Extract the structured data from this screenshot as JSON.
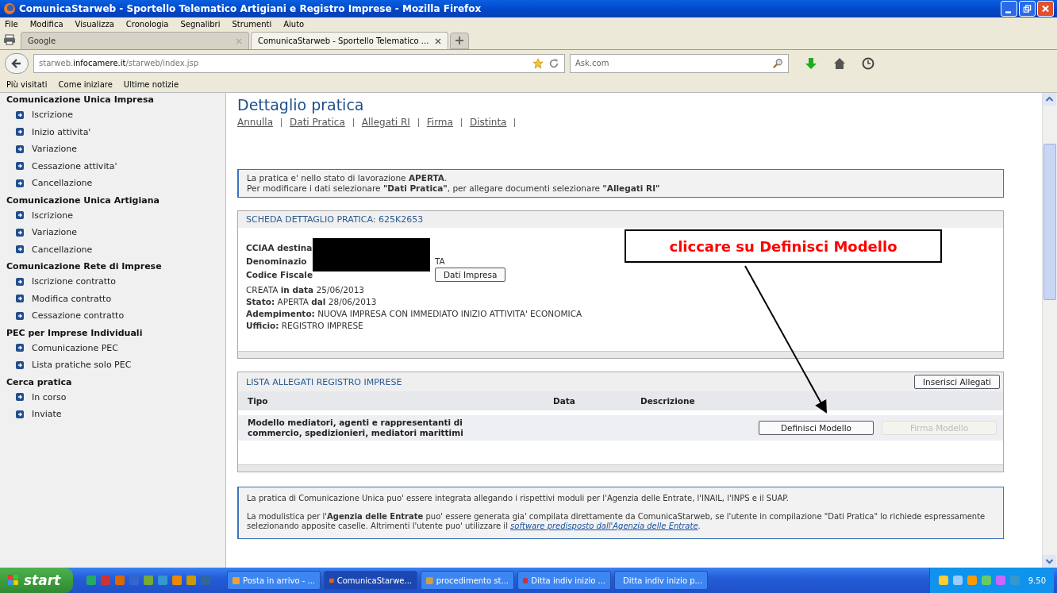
{
  "window": {
    "title": "ComunicaStarweb - Sportello Telematico Artigiani e Registro Imprese - Mozilla Firefox"
  },
  "menu": [
    "File",
    "Modifica",
    "Visualizza",
    "Cronologia",
    "Segnalibri",
    "Strumenti",
    "Aiuto"
  ],
  "tabs": [
    {
      "label": "Google",
      "selected": false
    },
    {
      "label": "ComunicaStarweb - Sportello Telematico ...",
      "selected": true
    }
  ],
  "address": {
    "prefix": "starweb.",
    "domain": "infocamere.it",
    "path": "/starweb/index.jsp"
  },
  "search": {
    "placeholder": "Ask.com"
  },
  "bookmarks": [
    "Più visitati",
    "Come iniziare",
    "Ultime notizie"
  ],
  "sidebar": {
    "sections": [
      {
        "title": "Comunicazione Unica Impresa",
        "items": [
          "Iscrizione",
          "Inizio attivita'",
          "Variazione",
          "Cessazione attivita'",
          "Cancellazione"
        ]
      },
      {
        "title": "Comunicazione Unica Artigiana",
        "items": [
          "Iscrizione",
          "Variazione",
          "Cancellazione"
        ]
      },
      {
        "title": "Comunicazione Rete di Imprese",
        "items": [
          "Iscrizione contratto",
          "Modifica contratto",
          "Cessazione contratto"
        ]
      },
      {
        "title": "PEC per Imprese Individuali",
        "items": [
          "Comunicazione PEC",
          "Lista pratiche solo PEC"
        ]
      },
      {
        "title": "Cerca pratica",
        "items": [
          "In corso",
          "Inviate"
        ]
      }
    ]
  },
  "page": {
    "title": "Dettaglio pratica",
    "links": [
      "Annulla",
      "Dati Pratica",
      "Allegati RI",
      "Firma",
      "Distinta"
    ]
  },
  "notice": [
    "La pratica e' nello stato di lavorazione **APERTA**.",
    "Per modificare i dati selezionare **\"Dati Pratica\"**, per allegare documenti selezionare **\"Allegati RI\"**"
  ],
  "scheda": {
    "title": "SCHEDA DETTAGLIO PRATICA: 625K2653",
    "redacted_rows": [
      {
        "label": "CCIAA destina"
      },
      {
        "label": "Denominazio",
        "tail": "TA"
      },
      {
        "label": "Codice Fiscale",
        "button": "Dati Impresa"
      }
    ],
    "lines": [
      "CREATA **in data** 25/06/2013",
      "**Stato:** APERTA **dal** 28/06/2013",
      "**Adempimento:** NUOVA IMPRESA CON IMMEDIATO INIZIO ATTIVITA' ECONOMICA",
      "**Ufficio:** REGISTRO IMPRESE"
    ]
  },
  "allegati": {
    "title": "LISTA ALLEGATI REGISTRO IMPRESE",
    "button": "Inserisci Allegati",
    "columns": [
      "Tipo",
      "Data",
      "Descrizione"
    ],
    "rows": [
      {
        "tipo": "Modello mediatori, agenti e rappresentanti di commercio, spedizionieri, mediatori marittimi",
        "buttons": [
          {
            "label": "Definisci Modello",
            "disabled": false
          },
          {
            "label": "Firma Modello",
            "disabled": true
          }
        ]
      }
    ]
  },
  "info": {
    "paragraph_1": "La pratica di Comunicazione Unica puo' essere integrata allegando i rispettivi moduli per l'Agenzia delle Entrate, l'INAIL, l'INPS e il SUAP.",
    "paragraph_2": "La modulistica per l'**Agenzia delle Entrate** puo' essere generata gia' compilata direttamente da ComunicaStarweb, se l'utente in compilazione \"Dati Pratica\" lo richiede espressamente selezionando apposite caselle. Altrimenti l'utente puo' utilizzare il",
    "link": "software predisposto dall'Agenzia delle Entrate",
    "after": "."
  },
  "annotation": {
    "text": "cliccare su Definisci Modello"
  },
  "taskbar": {
    "start": "start",
    "tasks": [
      {
        "label": "Posta in arrivo - ...",
        "selected": false
      },
      {
        "label": "ComunicaStarwe...",
        "selected": true
      },
      {
        "label": "procedimento st...",
        "selected": false
      },
      {
        "label": "Ditta indiv inizio ...",
        "selected": false
      },
      {
        "label": "Ditta indiv inizio p...",
        "selected": false
      }
    ],
    "clock": "9.50"
  }
}
